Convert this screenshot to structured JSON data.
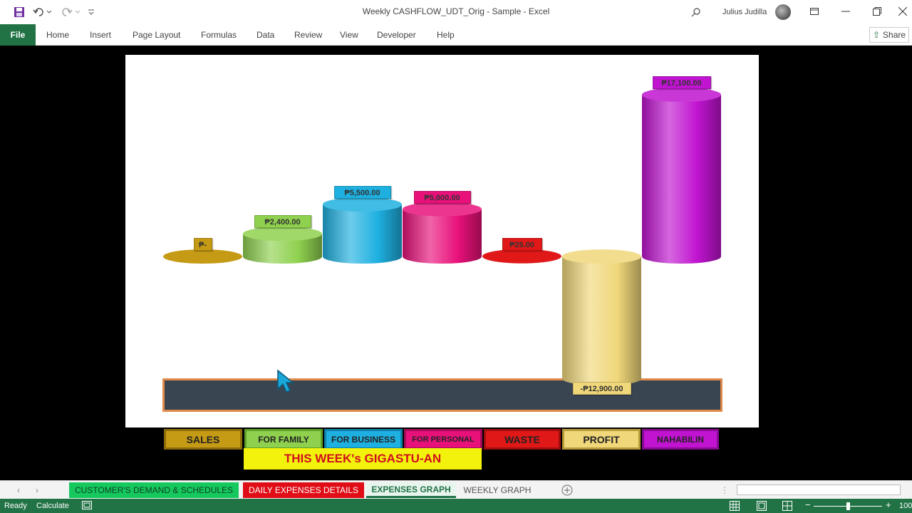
{
  "window": {
    "title": "Weekly CASHFLOW_UDT_Orig - Sample  -  Excel",
    "user": "Julius Judilla"
  },
  "ribbon": {
    "file": "File",
    "tabs": [
      "Home",
      "Insert",
      "Page Layout",
      "Formulas",
      "Data",
      "Review",
      "View",
      "Developer",
      "Help"
    ],
    "share": "Share"
  },
  "chart": {
    "labels": [
      "₱-",
      "₱2,400.00",
      "₱5,500.00",
      "₱5,000.00",
      "₱25.00",
      "-₱12,900.00",
      "₱17,100.00"
    ],
    "colors": [
      "#c59a14",
      "#8fd14f",
      "#1eb0e0",
      "#e8117a",
      "#e01818",
      "#f0d77a",
      "#c014d0"
    ]
  },
  "chart_data": {
    "type": "bar",
    "categories": [
      "SALES",
      "FOR FAMILY",
      "FOR BUSINESS",
      "FOR PERSONAL",
      "WASTE",
      "PROFIT",
      "NAHABILIN"
    ],
    "values": [
      0,
      2400,
      5500,
      5000,
      25,
      -12900,
      17100
    ],
    "title": "THIS WEEK's GIGASTU-AN"
  },
  "legend": {
    "items": [
      "SALES",
      "FOR FAMILY",
      "FOR BUSINESS",
      "FOR PERSONAL",
      "WASTE",
      "PROFIT",
      "NAHABILIN"
    ]
  },
  "banner": "THIS WEEK's GIGASTU-AN",
  "sheets": {
    "tabs": [
      "CUSTOMER'S DEMAND & SCHEDULES",
      "DAILY EXPENSES DETAILS",
      "EXPENSES GRAPH",
      "WEEKLY GRAPH"
    ],
    "active": "EXPENSES GRAPH"
  },
  "status": {
    "ready": "Ready",
    "calculate": "Calculate",
    "zoom": "100"
  }
}
